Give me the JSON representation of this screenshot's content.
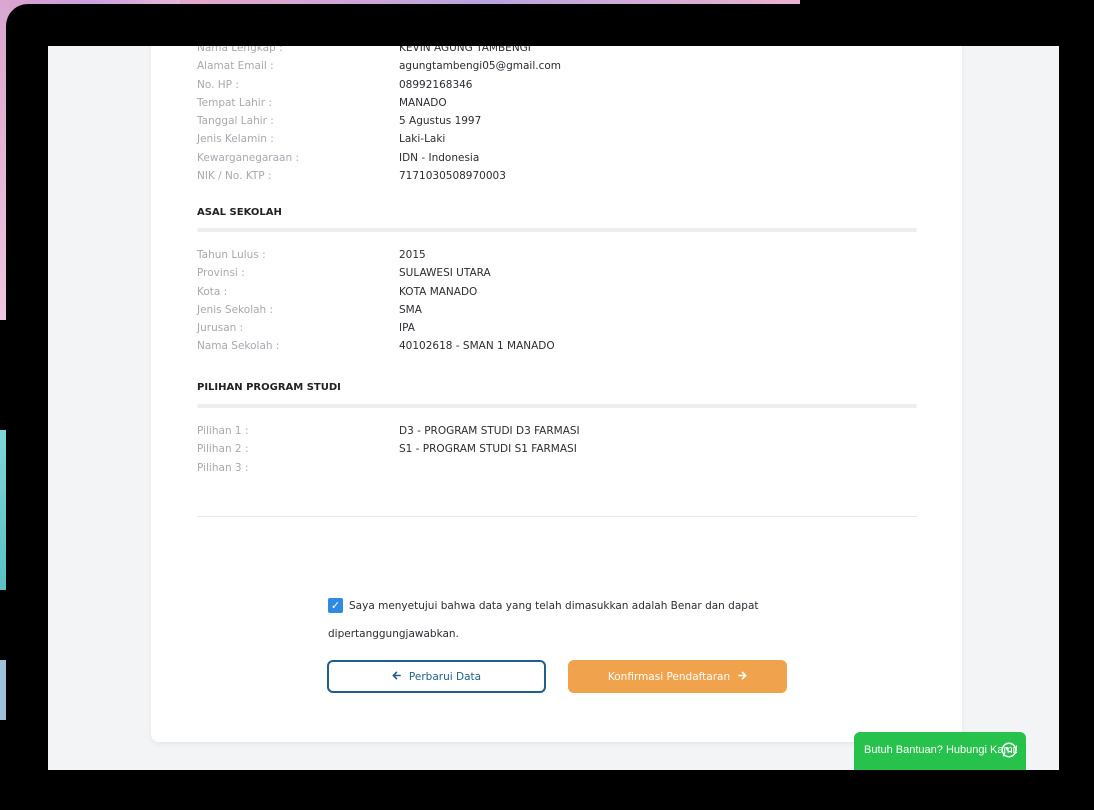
{
  "personal": {
    "rows": [
      {
        "label": "Nama Lengkap :",
        "value": "KEVIN AGUNG TAMBENGI"
      },
      {
        "label": "Alamat Email :",
        "value": "agungtambengi05@gmail.com"
      },
      {
        "label": "No. HP :",
        "value": "08992168346"
      },
      {
        "label": "Tempat Lahir :",
        "value": "MANADO"
      },
      {
        "label": "Tanggal Lahir :",
        "value": "5 Agustus 1997"
      },
      {
        "label": "Jenis Kelamin :",
        "value": "Laki-Laki"
      },
      {
        "label": "Kewarganegaraan :",
        "value": "IDN - Indonesia"
      },
      {
        "label": "NIK / No. KTP :",
        "value": "7171030508970003"
      }
    ]
  },
  "school": {
    "title": "ASAL SEKOLAH",
    "rows": [
      {
        "label": "Tahun Lulus :",
        "value": "2015"
      },
      {
        "label": "Provinsi :",
        "value": "SULAWESI UTARA"
      },
      {
        "label": "Kota :",
        "value": "KOTA MANADO"
      },
      {
        "label": "Jenis Sekolah :",
        "value": "SMA"
      },
      {
        "label": "Jurusan :",
        "value": "IPA"
      },
      {
        "label": "Nama Sekolah :",
        "value": "40102618 - SMAN 1 MANADO"
      }
    ]
  },
  "program": {
    "title": "PILIHAN PROGRAM STUDI",
    "rows": [
      {
        "label": "Pilihan 1 :",
        "value": "D3 - PROGRAM STUDI D3 FARMASI"
      },
      {
        "label": "Pilihan 2 :",
        "value": "S1 - PROGRAM STUDI S1 FARMASI"
      },
      {
        "label": "Pilihan 3 :",
        "value": ""
      }
    ]
  },
  "agreement": {
    "checked": true,
    "line1": "Saya menyetujui bahwa data yang telah dimasukkan adalah Benar dan dapat",
    "line2": "dipertanggungjawabkan."
  },
  "buttons": {
    "update": "Perbarui Data",
    "confirm": "Konfirmasi Pendaftaran"
  },
  "help": {
    "label": "Butuh Bantuan? Hubungi Kami!"
  },
  "colors": {
    "primary_button": "#f0a24c",
    "outline_button": "#1f5f8a",
    "checkbox": "#2f8be0",
    "help_widget": "#27c24c"
  }
}
